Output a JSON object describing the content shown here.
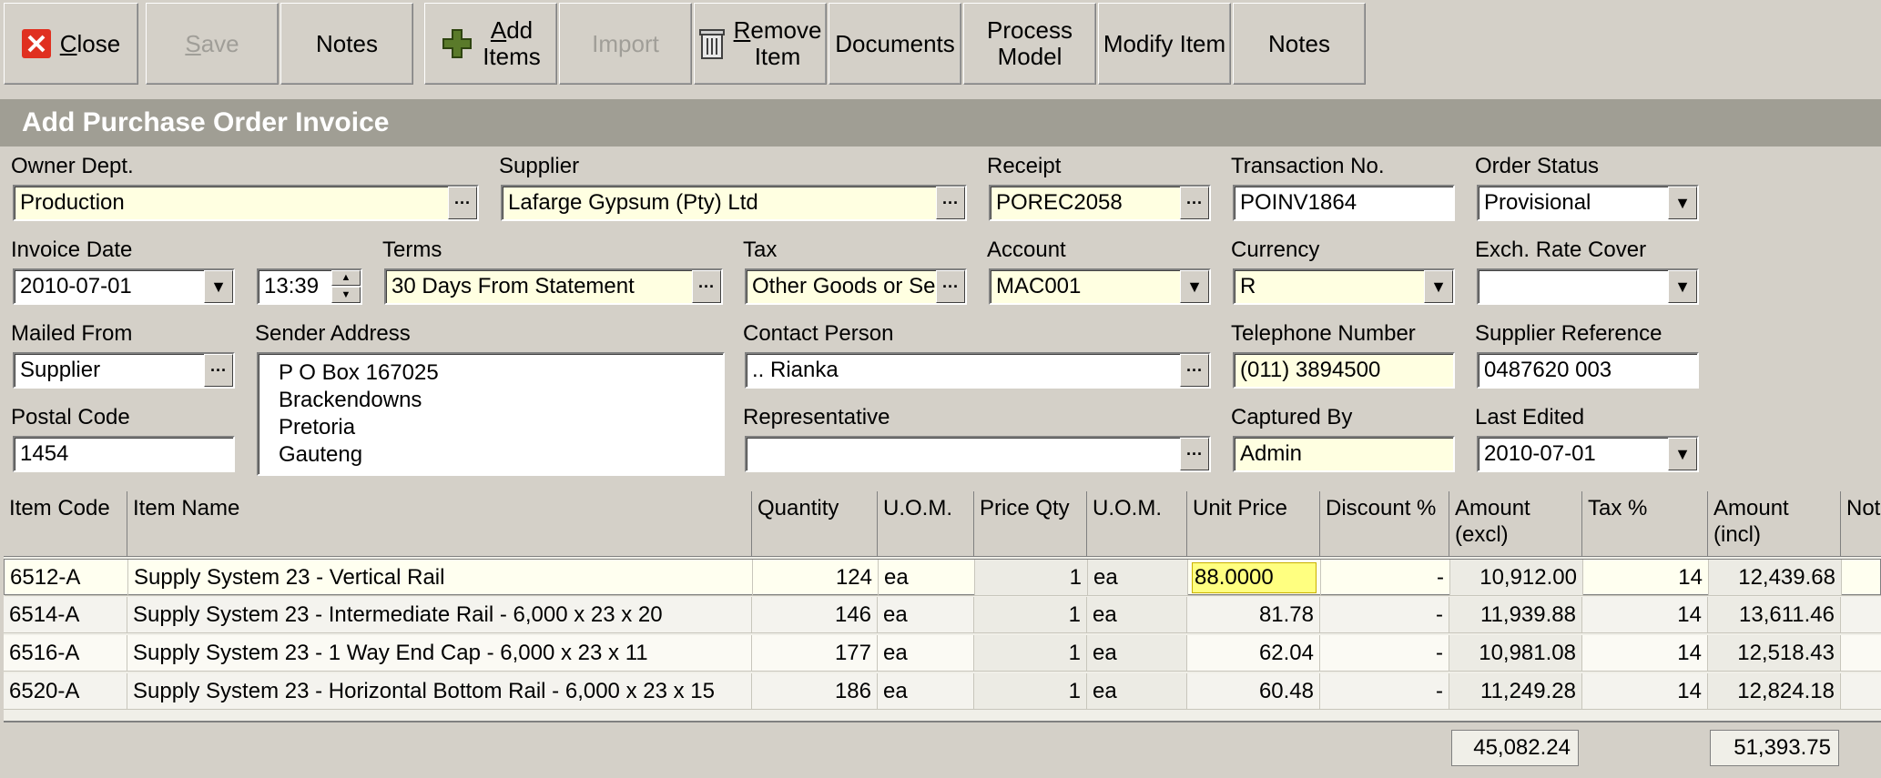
{
  "toolbar": {
    "close": {
      "pre": "",
      "ul": "C",
      "post": "lose"
    },
    "save": {
      "pre": "",
      "ul": "S",
      "post": "ave"
    },
    "notes1": "Notes",
    "add_items": {
      "l1u": "A",
      "l1": "dd",
      "l2": "Items"
    },
    "import": "Import",
    "remove_item": {
      "l1u": "R",
      "l1": "emove",
      "l2": "Item"
    },
    "documents": "Documents",
    "process_model": {
      "l1": "Process",
      "l2": "Model"
    },
    "modify_item": "Modify Item",
    "notes2": "Notes"
  },
  "title": "Add Purchase Order Invoice",
  "form": {
    "owner_dept": {
      "label": "Owner Dept.",
      "value": "Production"
    },
    "supplier": {
      "label": "Supplier",
      "value": "Lafarge Gypsum (Pty) Ltd"
    },
    "receipt": {
      "label": "Receipt",
      "value": "POREC2058"
    },
    "transaction_no": {
      "label": "Transaction No.",
      "value": "POINV1864"
    },
    "order_status": {
      "label": "Order Status",
      "value": "Provisional"
    },
    "invoice_date": {
      "label": "Invoice Date",
      "value": "2010-07-01"
    },
    "time": {
      "value": "13:39"
    },
    "terms": {
      "label": "Terms",
      "value": "30 Days From Statement"
    },
    "tax": {
      "label": "Tax",
      "value": "Other Goods or Se"
    },
    "account": {
      "label": "Account",
      "value": "MAC001"
    },
    "currency": {
      "label": "Currency",
      "value": "R"
    },
    "exch_rate_cover": {
      "label": "Exch. Rate Cover",
      "value": ""
    },
    "mailed_from": {
      "label": "Mailed From",
      "value": "Supplier"
    },
    "sender_address": {
      "label": "Sender Address",
      "lines": [
        "P O Box 167025",
        "Brackendowns",
        "Pretoria",
        "Gauteng"
      ]
    },
    "contact_person": {
      "label": "Contact Person",
      "value": ".. Rianka"
    },
    "telephone": {
      "label": "Telephone Number",
      "value": "(011) 3894500"
    },
    "supplier_reference": {
      "label": "Supplier Reference",
      "value": "0487620 003"
    },
    "postal_code": {
      "label": "Postal Code",
      "value": "1454"
    },
    "representative": {
      "label": "Representative",
      "value": ""
    },
    "captured_by": {
      "label": "Captured By",
      "value": "Admin"
    },
    "last_edited": {
      "label": "Last Edited",
      "value": "2010-07-01"
    }
  },
  "grid": {
    "headers": {
      "item_code": "Item Code",
      "item_name": "Item Name",
      "quantity": "Quantity",
      "uom1": "U.O.M.",
      "price_qty": "Price Qty",
      "uom2": "U.O.M.",
      "unit_price": "Unit Price",
      "discount": "Discount %",
      "amount_excl_1": "Amount",
      "amount_excl_2": "(excl)",
      "tax": "Tax %",
      "amount_incl_1": "Amount",
      "amount_incl_2": "(incl)",
      "notes": "Notes"
    },
    "rows": [
      {
        "code": "6512-A",
        "name": "Supply System 23 - Vertical Rail",
        "qty": "124",
        "uom": "ea",
        "price_qty": "1",
        "uom2": "ea",
        "unit_price": "88.0000",
        "discount": "-",
        "amount_excl": "10,912.00",
        "tax": "14",
        "amount_incl": "12,439.68"
      },
      {
        "code": "6514-A",
        "name": "Supply System 23 - Intermediate Rail - 6,000 x 23 x 20",
        "qty": "146",
        "uom": "ea",
        "price_qty": "1",
        "uom2": "ea",
        "unit_price": "81.78",
        "discount": "-",
        "amount_excl": "11,939.88",
        "tax": "14",
        "amount_incl": "13,611.46"
      },
      {
        "code": "6516-A",
        "name": "Supply System 23 - 1 Way End Cap - 6,000 x 23 x 11",
        "qty": "177",
        "uom": "ea",
        "price_qty": "1",
        "uom2": "ea",
        "unit_price": "62.04",
        "discount": "-",
        "amount_excl": "10,981.08",
        "tax": "14",
        "amount_incl": "12,518.43"
      },
      {
        "code": "6520-A",
        "name": "Supply System 23 - Horizontal Bottom Rail - 6,000 x 23 x 15",
        "qty": "186",
        "uom": "ea",
        "price_qty": "1",
        "uom2": "ea",
        "unit_price": "60.48",
        "discount": "-",
        "amount_excl": "11,249.28",
        "tax": "14",
        "amount_incl": "12,824.18"
      }
    ],
    "totals": {
      "amount_excl": "45,082.24",
      "amount_incl": "51,393.75"
    }
  }
}
